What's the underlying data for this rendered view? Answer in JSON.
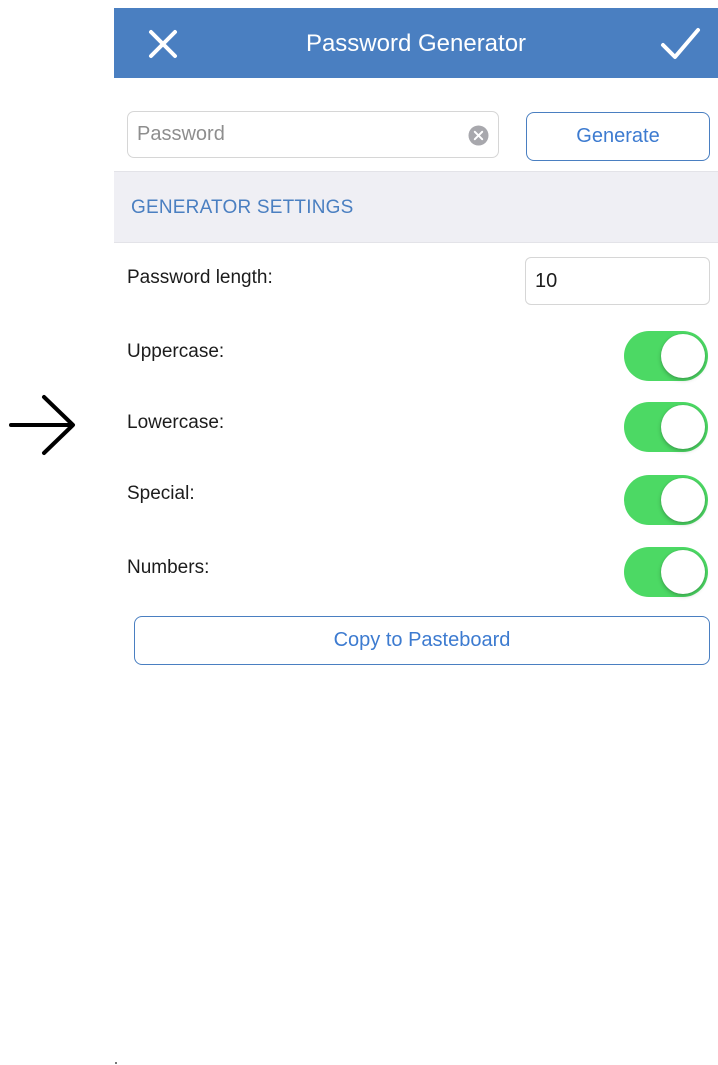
{
  "annotation": {
    "icon": "right-arrow-icon"
  },
  "nav_bar": {
    "title": "Password Generator",
    "close_icon": "close-icon",
    "done_icon": "checkmark-icon",
    "color": "#4a7fc1"
  },
  "password": {
    "value": "",
    "placeholder": "Password",
    "clear_icon": "clear-circle-icon"
  },
  "generate_label": "Generate",
  "settings": {
    "header": "GENERATOR SETTINGS",
    "length_label": "Password length:",
    "length_value": "10",
    "options": [
      {
        "label": "Uppercase:",
        "enabled": true
      },
      {
        "label": "Lowercase:",
        "enabled": true
      },
      {
        "label": "Special:",
        "enabled": true
      },
      {
        "label": "Numbers:",
        "enabled": true
      }
    ],
    "toggle_on_color": "#4cd964"
  },
  "copy_label": "Copy to Pasteboard"
}
